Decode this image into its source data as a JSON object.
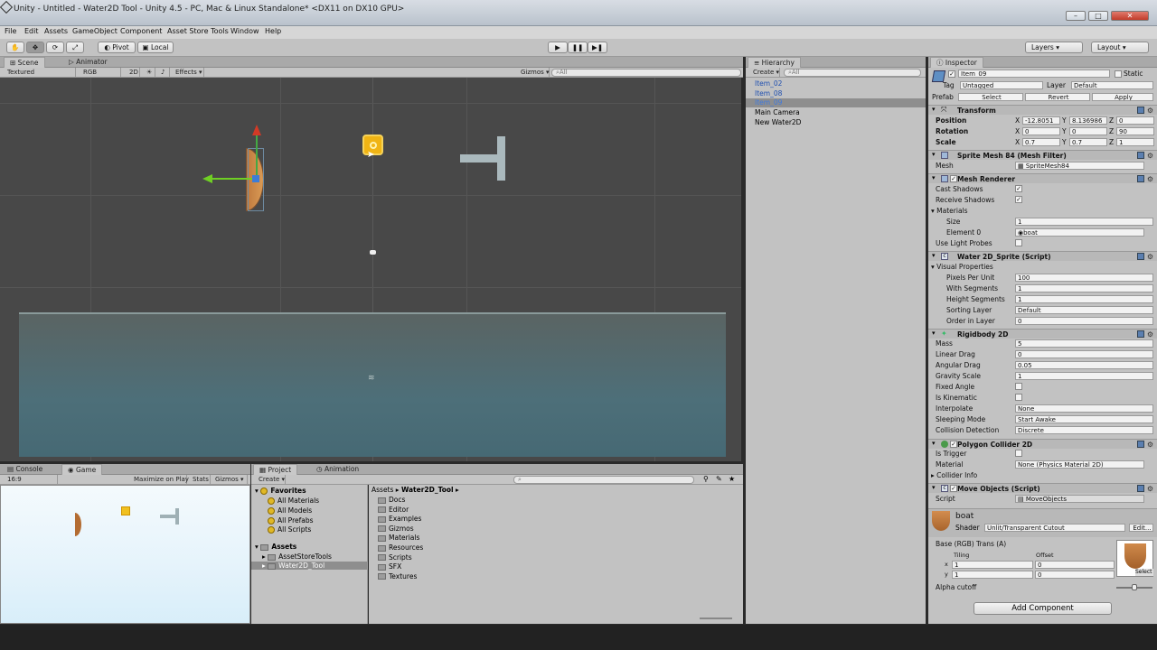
{
  "title": "Unity - Untitled - Water2D Tool - Unity 4.5 - PC, Mac & Linux Standalone* <DX11 on DX10 GPU>",
  "menus": [
    "File",
    "Edit",
    "Assets",
    "GameObject",
    "Component",
    "Asset Store Tools",
    "Window",
    "Help"
  ],
  "toolbar": {
    "pivot": "Pivot",
    "local": "Local",
    "layers": "Layers",
    "layout": "Layout"
  },
  "scene": {
    "tab_scene": "Scene",
    "tab_animator": "Animator",
    "textured": "Textured",
    "rgb": "RGB",
    "mode2d": "2D",
    "effects": "Effects",
    "gizmos": "Gizmos",
    "search": "All"
  },
  "game": {
    "tab_console": "Console",
    "tab_game": "Game",
    "aspect": "16:9",
    "maximize": "Maximize on Play",
    "stats": "Stats",
    "gizmos": "Gizmos"
  },
  "project": {
    "tab_project": "Project",
    "tab_animation": "Animation",
    "create": "Create",
    "favorites_title": "Favorites",
    "favorites": [
      "All Materials",
      "All Models",
      "All Prefabs",
      "All Scripts"
    ],
    "assets_title": "Assets",
    "asset_tree": [
      "AssetStoreTools",
      "Water2D_Tool"
    ],
    "path_root": "Assets",
    "path_leaf": "Water2D_Tool",
    "folders": [
      "Docs",
      "Editor",
      "Examples",
      "Gizmos",
      "Materials",
      "Resources",
      "Scripts",
      "SFX",
      "Textures"
    ]
  },
  "hierarchy": {
    "tab": "Hierarchy",
    "create": "Create",
    "search": "All",
    "items": [
      "Item_02",
      "Item_08",
      "Item_09",
      "Main Camera",
      "New Water2D"
    ],
    "selected_index": 2
  },
  "inspector": {
    "tab": "Inspector",
    "object_name": "Item_09",
    "static_label": "Static",
    "tag_label": "Tag",
    "tag_value": "Untagged",
    "layer_label": "Layer",
    "layer_value": "Default",
    "prefab_label": "Prefab",
    "prefab_select": "Select",
    "prefab_revert": "Revert",
    "prefab_apply": "Apply",
    "transform": {
      "title": "Transform",
      "rows": [
        {
          "label": "Position",
          "x": "-12.8051",
          "y": "8.136986",
          "z": "0"
        },
        {
          "label": "Rotation",
          "x": "0",
          "y": "0",
          "z": "90"
        },
        {
          "label": "Scale",
          "x": "0.7",
          "y": "0.7",
          "z": "1"
        }
      ]
    },
    "mesh_filter": {
      "title": "Sprite Mesh 84 (Mesh Filter)",
      "mesh_label": "Mesh",
      "mesh_value": "SpriteMesh84"
    },
    "mesh_renderer": {
      "title": "Mesh Renderer",
      "cast_shadows": "Cast Shadows",
      "receive_shadows": "Receive Shadows",
      "materials": "Materials",
      "size_label": "Size",
      "size_value": "1",
      "element_label": "Element 0",
      "element_value": "boat",
      "light_probes": "Use Light Probes"
    },
    "water_sprite": {
      "title": "Water 2D_Sprite (Script)",
      "visual": "Visual Properties",
      "rows": [
        {
          "label": "Pixels Per Unit",
          "value": "100"
        },
        {
          "label": "With Segments",
          "value": "1"
        },
        {
          "label": "Height Segments",
          "value": "1"
        },
        {
          "label": "Sorting Layer",
          "value": "Default"
        },
        {
          "label": "Order in Layer",
          "value": "0"
        }
      ]
    },
    "rigidbody": {
      "title": "Rigidbody 2D",
      "rows": [
        {
          "label": "Mass",
          "value": "5"
        },
        {
          "label": "Linear Drag",
          "value": "0"
        },
        {
          "label": "Angular Drag",
          "value": "0.05"
        },
        {
          "label": "Gravity Scale",
          "value": "1"
        },
        {
          "label": "Fixed Angle",
          "value": ""
        },
        {
          "label": "Is Kinematic",
          "value": ""
        },
        {
          "label": "Interpolate",
          "value": "None"
        },
        {
          "label": "Sleeping Mode",
          "value": "Start Awake"
        },
        {
          "label": "Collision Detection",
          "value": "Discrete"
        }
      ]
    },
    "polygon": {
      "title": "Polygon Collider 2D",
      "is_trigger": "Is Trigger",
      "material_label": "Material",
      "material_value": "None (Physics Material 2D)",
      "collider_info": "Collider Info"
    },
    "move": {
      "title": "Move Objects (Script)",
      "script_label": "Script",
      "script_value": "MoveObjects"
    },
    "material": {
      "name": "boat",
      "shader_label": "Shader",
      "shader_value": "Unlit/Transparent Cutout",
      "edit": "Edit...",
      "base": "Base (RGB) Trans (A)",
      "tiling": "Tiling",
      "offset": "Offset",
      "tx": "1",
      "ty": "1",
      "ox": "0",
      "oy": "0",
      "select": "Select",
      "alpha": "Alpha cutoff"
    },
    "add_component": "Add Component"
  }
}
